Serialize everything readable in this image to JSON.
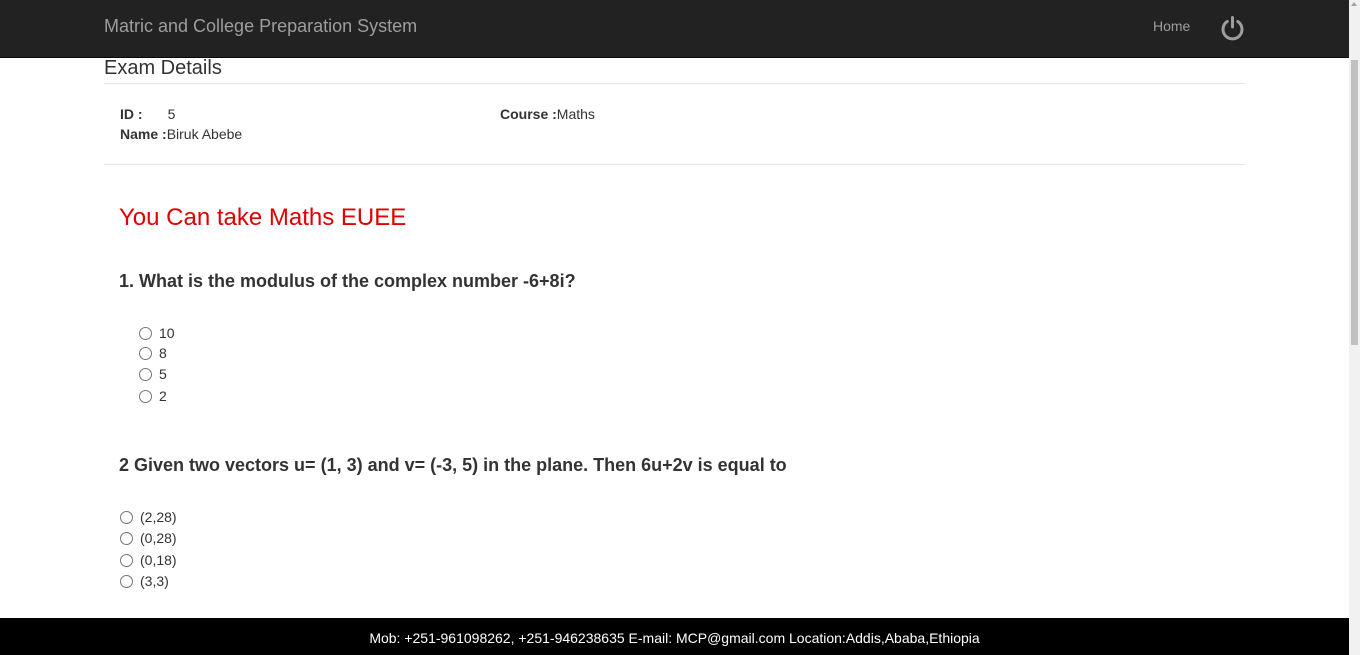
{
  "navbar": {
    "brand": "Matric and College Preparation System",
    "home": "Home",
    "power_icon": "power-icon"
  },
  "page": {
    "title": "Exam Details"
  },
  "details": {
    "id_label": "ID :",
    "id_value": "5",
    "name_label": "Name :",
    "name_value": "Biruk Abebe",
    "course_label": "Course :",
    "course_value": "Maths"
  },
  "notice": "You Can take Maths EUEE",
  "questions": [
    {
      "text": "1. What is the modulus of the complex number -6+8i?",
      "options": [
        "10",
        "8",
        "5",
        "2"
      ]
    },
    {
      "text": "2 Given two vectors u= (1, 3) and v= (-3, 5) in the plane. Then 6u+2v is equal to",
      "options": [
        "(2,28)",
        "(0,28)",
        "(0,18)",
        "(3,3)"
      ]
    }
  ],
  "footer": "Mob: +251-961098262, +251-946238635 E-mail: MCP@gmail.com Location:Addis,Ababa,Ethiopia",
  "colors": {
    "navbar_bg": "#222222",
    "notice": "#e00000",
    "footer_bg": "#000000"
  }
}
